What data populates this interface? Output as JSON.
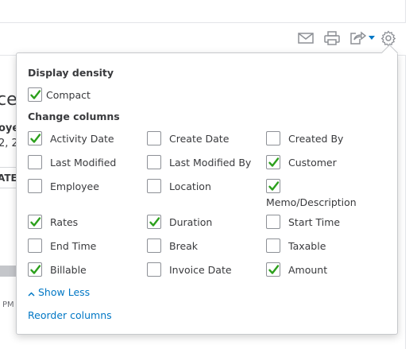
{
  "background": {
    "fragments": [
      "ces",
      "oye",
      "2, 2",
      "ATES",
      "PM"
    ]
  },
  "toolbar": {
    "icons": [
      "mail-icon",
      "print-icon",
      "export-icon",
      "gear-icon"
    ]
  },
  "panel": {
    "display_density": {
      "title": "Display density",
      "compact": {
        "label": "Compact",
        "checked": true
      }
    },
    "change_columns": {
      "title": "Change columns",
      "options": [
        {
          "label": "Activity Date",
          "checked": true
        },
        {
          "label": "Create Date",
          "checked": false
        },
        {
          "label": "Created By",
          "checked": false
        },
        {
          "label": "Last Modified",
          "checked": false
        },
        {
          "label": "Last Modified By",
          "checked": false
        },
        {
          "label": "Customer",
          "checked": true
        },
        {
          "label": "Employee",
          "checked": false
        },
        {
          "label": "Location",
          "checked": false
        },
        {
          "label": "Memo/Description",
          "checked": true
        },
        {
          "label": "Rates",
          "checked": true
        },
        {
          "label": "Duration",
          "checked": true
        },
        {
          "label": "Start Time",
          "checked": false
        },
        {
          "label": "End Time",
          "checked": false
        },
        {
          "label": "Break",
          "checked": false
        },
        {
          "label": "Taxable",
          "checked": false
        },
        {
          "label": "Billable",
          "checked": true
        },
        {
          "label": "Invoice Date",
          "checked": false
        },
        {
          "label": "Amount",
          "checked": true
        }
      ]
    },
    "show_less": "Show Less",
    "reorder_columns": "Reorder columns"
  },
  "colors": {
    "check": "#2ca01c",
    "link": "#0077c5",
    "text": "#393a3d",
    "icon": "#8d9096"
  }
}
